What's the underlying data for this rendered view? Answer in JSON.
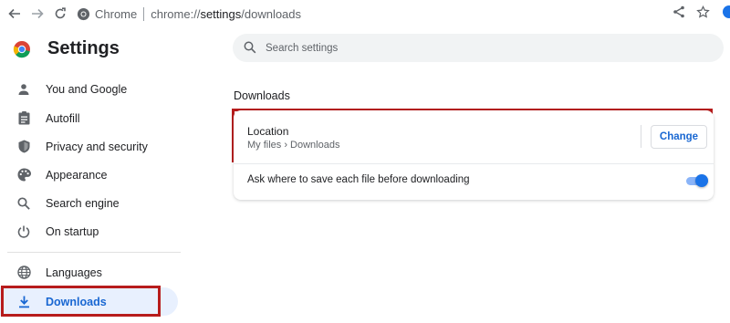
{
  "browser": {
    "chip_label": "Chrome",
    "url_prefix": "chrome://",
    "url_host": "settings",
    "url_path": "/downloads"
  },
  "sidebar": {
    "title": "Settings",
    "items": [
      {
        "label": "You and Google",
        "icon": "person-icon"
      },
      {
        "label": "Autofill",
        "icon": "clipboard-icon"
      },
      {
        "label": "Privacy and security",
        "icon": "shield-icon"
      },
      {
        "label": "Appearance",
        "icon": "palette-icon"
      },
      {
        "label": "Search engine",
        "icon": "search-icon"
      },
      {
        "label": "On startup",
        "icon": "power-icon"
      },
      {
        "label": "Languages",
        "icon": "globe-icon"
      },
      {
        "label": "Downloads",
        "icon": "download-icon",
        "active": true
      }
    ]
  },
  "search": {
    "placeholder": "Search settings"
  },
  "main": {
    "section_title": "Downloads",
    "location": {
      "title": "Location",
      "path": "My files › Downloads",
      "button_label": "Change"
    },
    "ask_setting": {
      "label": "Ask where to save each file before downloading",
      "enabled": true
    }
  },
  "colors": {
    "accent": "#1a73e8",
    "active_bg": "#e8f0fe",
    "highlight_border": "#b71c1c"
  }
}
